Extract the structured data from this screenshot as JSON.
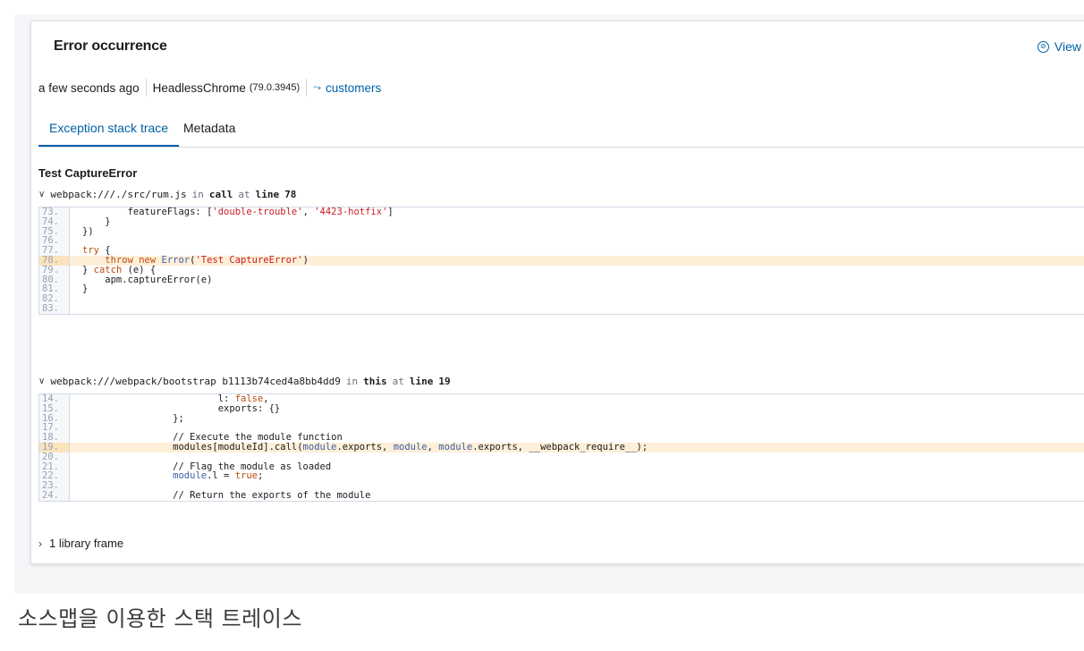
{
  "panel": {
    "title": "Error occurrence",
    "view_link": "View",
    "meta": {
      "time": "a few seconds ago",
      "browser": "HeadlessChrome",
      "browser_version": "(79.0.3945)",
      "transaction": "customers"
    },
    "tabs": [
      {
        "label": "Exception stack trace",
        "active": true
      },
      {
        "label": "Metadata",
        "active": false
      }
    ],
    "exception_title": "Test CaptureError",
    "frames": [
      {
        "file": "webpack:///./src/rum.js",
        "in": "in",
        "func": "call",
        "at": "at",
        "line_word": "line",
        "line": "78"
      },
      {
        "file": "webpack:///webpack/bootstrap b1113b74ced4a8bb4dd9",
        "in": "in",
        "func": "this",
        "at": "at",
        "line_word": "line",
        "line": "19"
      }
    ],
    "library_frames": "1 library frame"
  },
  "code1": {
    "nums": [
      "73.",
      "74.",
      "75.",
      "76.",
      "77.",
      "78.",
      "79.",
      "80.",
      "81.",
      "82.",
      "83."
    ],
    "l73a": "        featureFlags: [",
    "l73b": "'double-trouble'",
    "l73c": ", ",
    "l73d": "'4423-hotfix'",
    "l73e": "]",
    "l74": "    }",
    "l75": "})",
    "l77a": "try",
    "l77b": " {",
    "l78a": "    throw new ",
    "l78b": "Error",
    "l78c": "(",
    "l78d": "'Test CaptureError'",
    "l78e": ")",
    "l79a": "} ",
    "l79b": "catch",
    "l79c": " (e) {",
    "l80": "    apm.captureError(e)",
    "l81": "}"
  },
  "code2": {
    "nums": [
      "14.",
      "15.",
      "16.",
      "17.",
      "18.",
      "19.",
      "20.",
      "21.",
      "22.",
      "23.",
      "24."
    ],
    "l14a": "                        l: ",
    "l14b": "false",
    "l14c": ",",
    "l15": "                        exports: {}",
    "l16": "                };",
    "l18": "                // Execute the module function",
    "l19a": "                modules[moduleId].call(",
    "l19b": "module",
    "l19c": ".exports, ",
    "l19d": "module",
    "l19e": ", ",
    "l19f": "module",
    "l19g": ".exports, __webpack_require__);",
    "l21": "                // Flag the module as loaded",
    "l22a": "                ",
    "l22b": "module",
    "l22c": ".l = ",
    "l22d": "true",
    "l22e": ";",
    "l24": "                // Return the exports of the module"
  },
  "caption": "소스맵을 이용한 스택 트레이스",
  "colors": {
    "link": "#0061a6",
    "highlight": "#fdefd8",
    "string": "#c61e25",
    "keyword": "#bd4b0c",
    "comment": "#017d73"
  },
  "icons": {
    "view": "eye-closed-icon",
    "transaction": "transaction-icon",
    "expand": "chevron-down-icon",
    "collapse": "chevron-right-icon"
  }
}
